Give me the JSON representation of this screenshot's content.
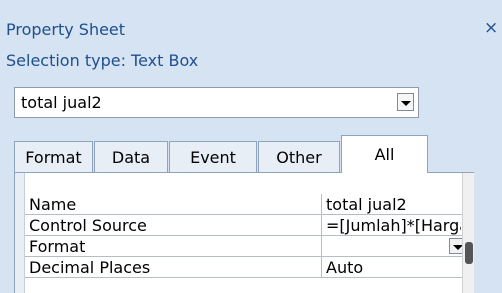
{
  "panel": {
    "title": "Property Sheet",
    "close_glyph": "×",
    "selection_type": "Selection type:  Text Box"
  },
  "object_selector": {
    "value": "total jual2"
  },
  "tabs": [
    {
      "label": "Format"
    },
    {
      "label": "Data"
    },
    {
      "label": "Event"
    },
    {
      "label": "Other"
    },
    {
      "label": "All",
      "active": true
    }
  ],
  "properties": [
    {
      "name": "Name",
      "value": "total jual2"
    },
    {
      "name": "Control Source",
      "value": "=[Jumlah]*[Harga"
    },
    {
      "name": "Format",
      "value": ""
    },
    {
      "name": "Decimal Places",
      "value": "Auto"
    }
  ]
}
